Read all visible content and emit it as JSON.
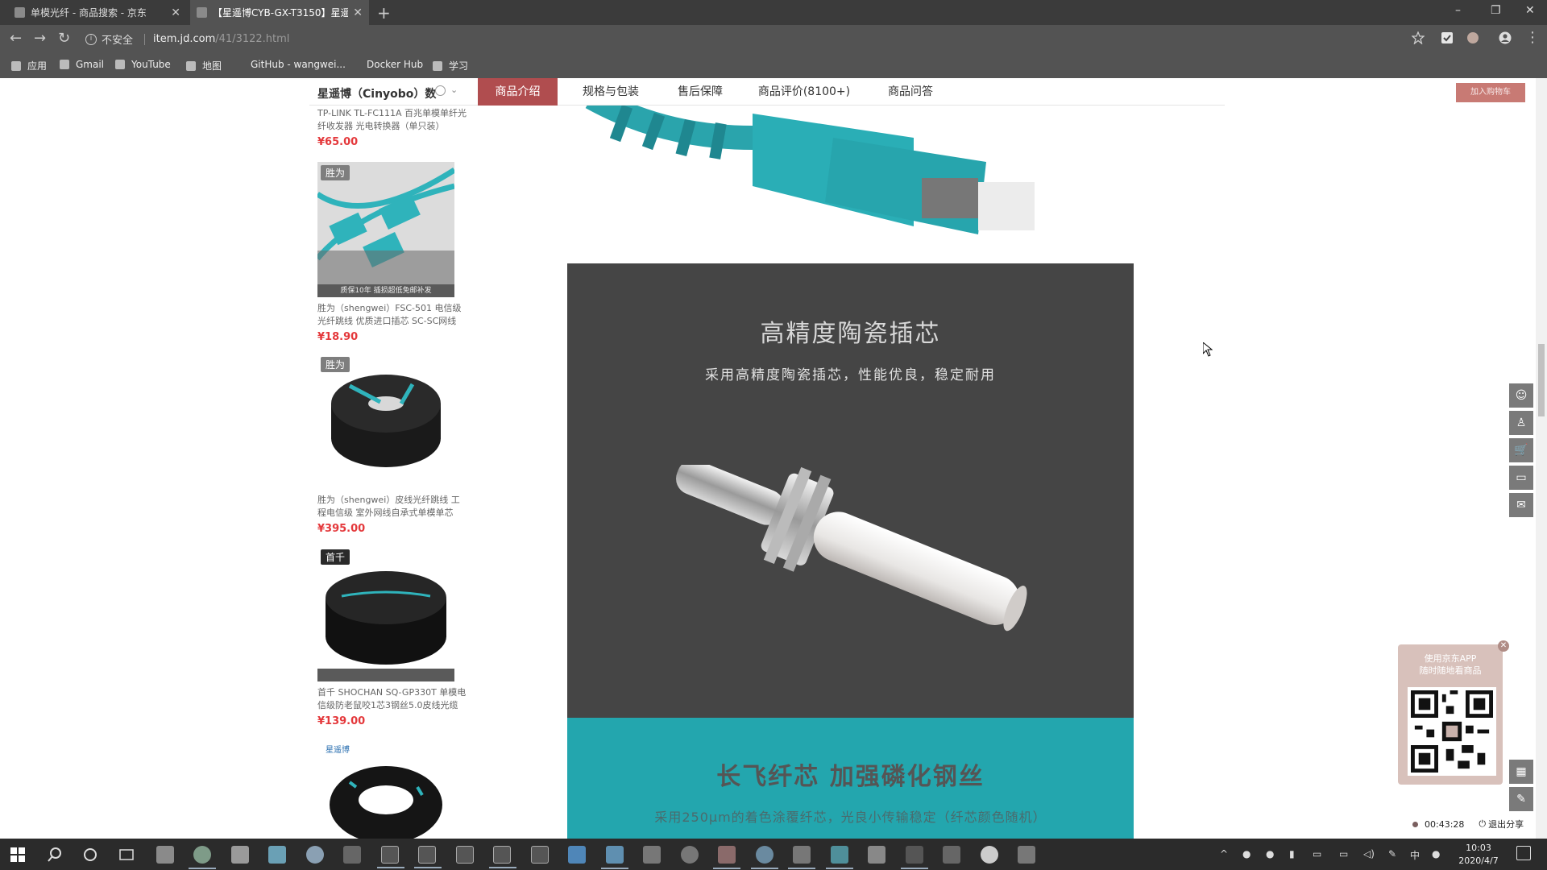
{
  "browser": {
    "tabs": [
      {
        "title": "单模光纤 - 商品搜索 - 京东",
        "active": false
      },
      {
        "title": "【星遥博CYB-GX-T3150】星遥",
        "active": true
      }
    ],
    "new_tab": "+",
    "window_controls": {
      "minimize": "–",
      "restore": "❐",
      "close": "✕"
    },
    "omnibox": {
      "security": "不安全",
      "host": "item.jd.com",
      "path": "/41/3122.html"
    },
    "bookmarks": [
      "应用",
      "Gmail",
      "YouTube",
      "地图",
      "GitHub - wangwei...",
      "Docker Hub",
      "学习"
    ]
  },
  "shop_bar": {
    "shop_name": "星遥博（Cinyobo）数",
    "tabs": [
      "商品介绍",
      "规格与包装",
      "售后保障",
      "商品评价(8100+)",
      "商品问答"
    ],
    "active_tab": "商品介绍",
    "add_to_cart": "加入购物车"
  },
  "sidebar": {
    "items": [
      {
        "title": "TP-LINK TL-FC111A 百兆单模单纤光纤收发器 光电转换器（单只装）",
        "price": "¥65.00",
        "brand": "",
        "promo": ""
      },
      {
        "title": "胜为（shengwei）FSC-501 电信级光纤跳线 优质进口插芯 SC-SC网线",
        "price": "¥18.90",
        "brand": "胜为",
        "promo": "质保10年 插损超低免邮补发"
      },
      {
        "title": "胜为（shengwei）皮线光纤跳线 工程电信级 室外网线自承式单模单芯",
        "price": "¥395.00",
        "brand": "胜为",
        "promo": ""
      },
      {
        "title": "首千 SHOCHAN SQ-GP330T 单模电信级防老鼠咬1芯3钢丝5.0皮线光缆",
        "price": "¥139.00",
        "brand": "首千",
        "promo": ""
      },
      {
        "title": "",
        "price": "",
        "brand": "星遥博",
        "promo": ""
      }
    ]
  },
  "content": {
    "panel1": {
      "title": "高精度陶瓷插芯",
      "subtitle": "采用高精度陶瓷插芯，性能优良，稳定耐用"
    },
    "panel2": {
      "title": "长飞纤芯  加强磷化钢丝",
      "subtitle": "采用250μm的着色涂覆纤芯，光良小传输稳定（纤芯颜色随机）"
    }
  },
  "qr_popup": {
    "line1": "使用京东APP",
    "line2": "随时随地看商品"
  },
  "recording": {
    "time": "00:43:28",
    "stop_label": "退出分享"
  },
  "taskbar": {
    "time": "10:03",
    "date": "2020/4/7"
  },
  "colors": {
    "jd_red": "#e4393c",
    "teal": "#23a6ae",
    "panel_dark": "#454545"
  }
}
